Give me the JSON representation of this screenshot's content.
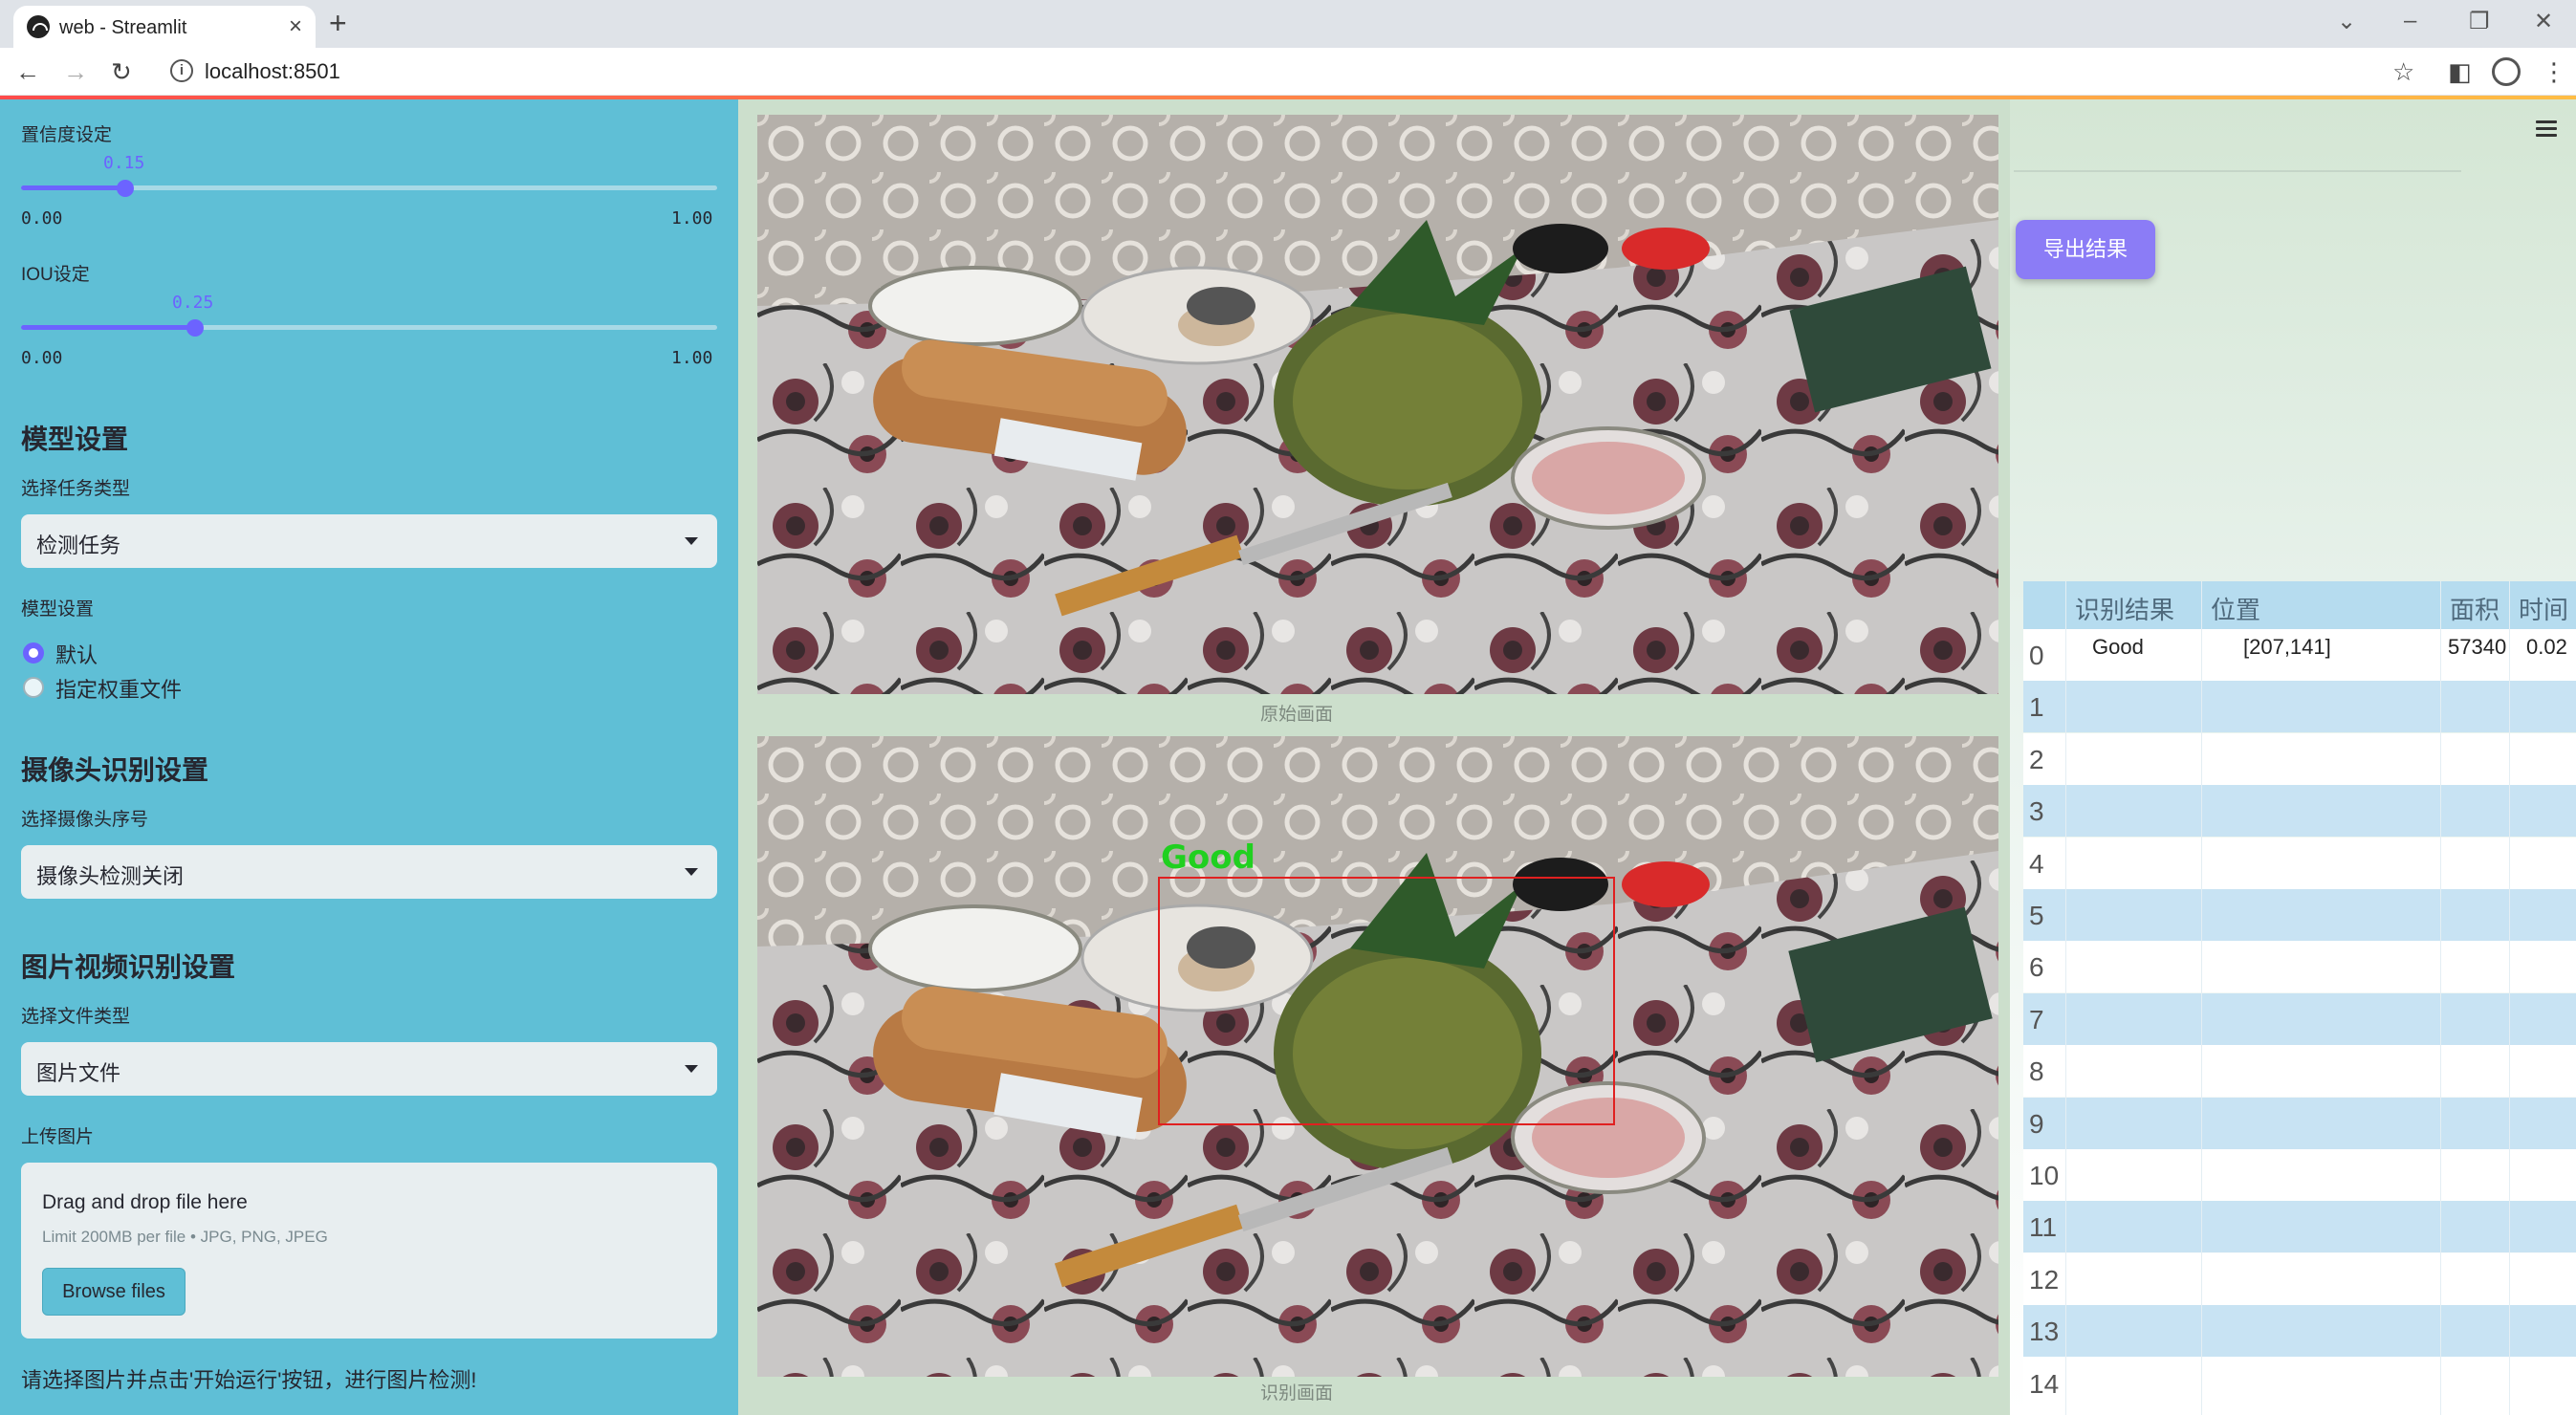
{
  "browser": {
    "tab_title": "web - Streamlit",
    "new_tab": "+",
    "tab_close": "×",
    "url": "localhost:8501",
    "url_info": "i",
    "nav_back": "←",
    "nav_forward": "→",
    "nav_reload": "↻",
    "bookmark": "☆",
    "sidepanel": "◧",
    "menu": "⋮",
    "win_dropdown": "⌄",
    "win_minimize": "–",
    "win_restore": "❐",
    "win_close": "✕"
  },
  "sidebar": {
    "confidence": {
      "label": "置信度设定",
      "value": "0.15",
      "min": "0.00",
      "max": "1.00",
      "level": 0.15
    },
    "iou": {
      "label": "IOU设定",
      "value": "0.25",
      "min": "0.00",
      "max": "1.00",
      "level": 0.25
    },
    "model_section": "模型设置",
    "task_type_label": "选择任务类型",
    "task_type_value": "检测任务",
    "model_setting_label": "模型设置",
    "radio_default": "默认",
    "radio_weights": "指定权重文件",
    "camera_section": "摄像头识别设置",
    "camera_label": "选择摄像头序号",
    "camera_value": "摄像头检测关闭",
    "media_section": "图片视频识别设置",
    "file_type_label": "选择文件类型",
    "file_type_value": "图片文件",
    "upload_label": "上传图片",
    "upload_drag": "Drag and drop file here",
    "upload_limit": "Limit 200MB per file • JPG, PNG, JPEG",
    "browse_button": "Browse files",
    "hint": "请选择图片并点击'开始运行'按钮，进行图片检测!"
  },
  "main": {
    "caption_original": "原始画面",
    "caption_detected": "识别画面",
    "detection_label": "Good",
    "export_button": "导出结果",
    "accent_color": "#8b7cf6"
  },
  "table": {
    "headers": [
      "识别结果",
      "位置",
      "面积",
      "时间"
    ],
    "rows": [
      {
        "idx": "0",
        "result": "Good",
        "pos": "[207,141]",
        "area": "57340",
        "time": "0.02"
      },
      {
        "idx": "1"
      },
      {
        "idx": "2"
      },
      {
        "idx": "3"
      },
      {
        "idx": "4"
      },
      {
        "idx": "5"
      },
      {
        "idx": "6"
      },
      {
        "idx": "7"
      },
      {
        "idx": "8"
      },
      {
        "idx": "9"
      },
      {
        "idx": "10"
      },
      {
        "idx": "11"
      },
      {
        "idx": "12"
      },
      {
        "idx": "13"
      },
      {
        "idx": "14"
      }
    ]
  }
}
